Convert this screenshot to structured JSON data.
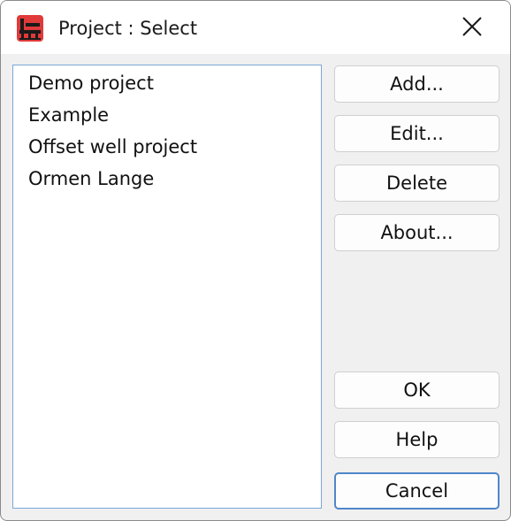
{
  "window": {
    "title": "Project : Select",
    "icon": "oil-rig-app-icon",
    "close_icon": "close-icon"
  },
  "projects": [
    {
      "label": "Demo project"
    },
    {
      "label": "Example"
    },
    {
      "label": "Offset well project"
    },
    {
      "label": "Ormen Lange"
    }
  ],
  "buttons": {
    "add": "Add...",
    "edit": "Edit...",
    "delete": "Delete",
    "about": "About...",
    "ok": "OK",
    "help": "Help",
    "cancel": "Cancel"
  },
  "colors": {
    "listbox_border": "#7aa7d8",
    "default_button_border": "#4f86c9",
    "app_icon": "#e03a3a"
  }
}
